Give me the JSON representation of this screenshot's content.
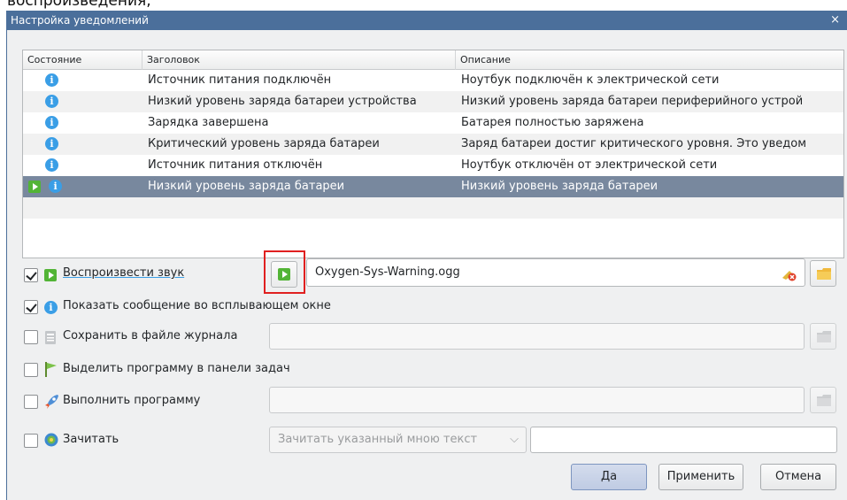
{
  "top_fragment": "воспроизведения,",
  "window": {
    "title": "Настройка уведомлений",
    "close_glyph": "×"
  },
  "table": {
    "headers": [
      "Состояние",
      "Заголовок",
      "Описание"
    ],
    "rows": [
      {
        "status": "info",
        "title": "Источник питания подключён",
        "description": "Ноутбук подключён к электрической сети"
      },
      {
        "status": "info",
        "title": "Низкий уровень заряда батареи устройства",
        "description": "Низкий уровень заряда батареи периферийного устрой"
      },
      {
        "status": "info",
        "title": "Зарядка завершена",
        "description": "Батарея полностью заряжена"
      },
      {
        "status": "info",
        "title": "Критический уровень заряда батареи",
        "description": "Заряд батареи достиг критического уровня. Это уведом"
      },
      {
        "status": "info",
        "title": "Источник питания отключён",
        "description": "Ноутбук отключён от электрической сети"
      },
      {
        "status": "sound+info",
        "title": "Низкий уровень заряда батареи",
        "description": "Низкий уровень заряда батареи"
      }
    ],
    "selected_row": 5
  },
  "options": {
    "play_sound": {
      "label": "Воспроизвести звук",
      "checked": true,
      "file": "Oxygen-Sys-Warning.ogg"
    },
    "show_popup": {
      "label": "Показать сообщение во всплывающем окне",
      "checked": true
    },
    "log_to_file": {
      "label": "Сохранить в файле журнала",
      "checked": false,
      "value": ""
    },
    "taskbar": {
      "label": "Выделить программу в панели задач",
      "checked": false
    },
    "run_command": {
      "label": "Выполнить программу",
      "checked": false,
      "value": ""
    },
    "speech": {
      "label": "Зачитать",
      "checked": false,
      "mode": "Зачитать указанный мною текст",
      "value": ""
    }
  },
  "buttons": {
    "ok": "Да",
    "apply": "Применить",
    "cancel": "Отмена"
  },
  "colors": {
    "titlebar": "#4b6f9b",
    "selection": "#78889e",
    "highlight_box": "#e02020",
    "info": "#3a9ee6",
    "play": "#52b436"
  }
}
